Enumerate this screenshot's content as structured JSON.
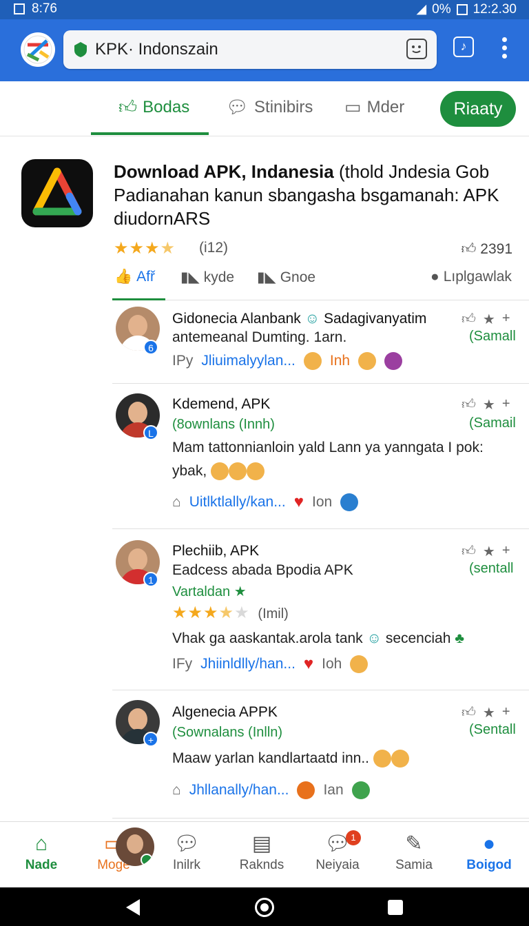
{
  "status": {
    "time": "8:76",
    "battery": "0%",
    "clock": "12:2.30"
  },
  "browser": {
    "url": "KPK· Indonszain"
  },
  "toptabs": [
    {
      "label": "Bodas",
      "icon": "thumbs-up-icon"
    },
    {
      "label": "Stinibirs",
      "icon": "chat-icon"
    },
    {
      "label": "Mder",
      "icon": "message-icon"
    }
  ],
  "cta": "Riaaty",
  "app": {
    "title_bold": "Download APK, Indanesia",
    "title_rest": " (thold Jndesia Gob Padianahan kanun sbangasha bsgamanah: APK diudornARS",
    "rating_count": "(i12)",
    "likes": "2391",
    "rating": 3.5
  },
  "subtabs": [
    {
      "label": "Afř",
      "icon": "like-icon"
    },
    {
      "label": "kyde",
      "icon": "dislike-icon"
    },
    {
      "label": "Gnoe",
      "icon": "dislike-icon"
    },
    {
      "label": "Lıplgawlak",
      "icon": "dot-icon"
    }
  ],
  "comments": [
    {
      "name": "Gidonecia Alanbank",
      "name_extra": "Sadagivanyatim",
      "line1": "antemeanal Dumting. 1arn.",
      "follow": "(Samall",
      "badge": "6",
      "footer_left": "IPy",
      "footer_link": "Jliuimalyylan...",
      "footer_extra": "Inh"
    },
    {
      "name": "Kdemend, APK",
      "sub": "(8ownlans (Innh)",
      "line1": "Mam tattonnianloin yald Lann ya yanngata I pok:",
      "line2": "ybak,",
      "follow": "(Samail",
      "badge": "L",
      "footer_link": "Uitlktlally/kan...",
      "footer_extra": "Ion"
    },
    {
      "name": "Plechiib, APK",
      "line1": "Eadcess abada Bpodia APK",
      "sub": "Vartaldan",
      "rating_count": "(Imil)",
      "line2": "Vhak ga aaskantak.arola tank",
      "line2_extra": "secenciah",
      "follow": "(sentall",
      "badge": "1",
      "footer_left": "IFy",
      "footer_link": "Jhiinldlly/han...",
      "footer_extra": "Ioh"
    },
    {
      "name": "Algenecia APPK",
      "sub": "(Sownalans (Inlln)",
      "line1": "Maaw yarlan kandlartaatd inn..",
      "follow": "(Sentall",
      "badge": "+",
      "footer_link": "Jhllanally/han...",
      "footer_extra": "Ian"
    }
  ],
  "bottomnav": [
    {
      "label": "Nade",
      "icon": "home-icon"
    },
    {
      "label": "Moge",
      "icon": "video-icon"
    },
    {
      "label": "Inilrk",
      "icon": "chat-bubble-icon"
    },
    {
      "label": "Raknds",
      "icon": "news-icon"
    },
    {
      "label": "Neiyaia",
      "icon": "notification-icon",
      "badge": "1"
    },
    {
      "label": "Samia",
      "icon": "edit-icon"
    },
    {
      "label": "Boigod",
      "icon": "profile-icon"
    }
  ]
}
